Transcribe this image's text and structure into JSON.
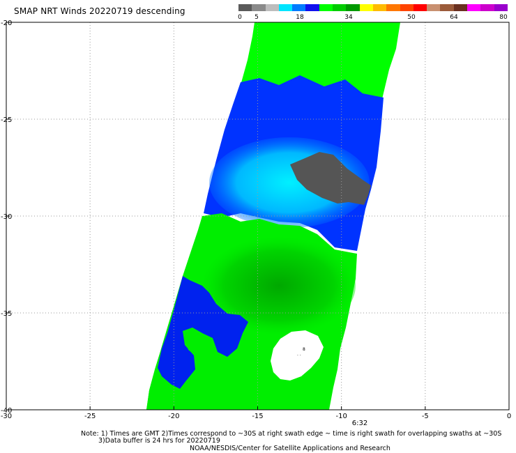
{
  "title": "SMAP NRT Winds  20220719  descending",
  "colorbar": {
    "labels": [
      "0",
      "5",
      "18",
      "34",
      "50",
      "64",
      "80"
    ],
    "segments": [
      {
        "color": "#5a5a5a"
      },
      {
        "color": "#8a8a8a"
      },
      {
        "color": "#bdbdbd"
      },
      {
        "color": "#00e5ff"
      },
      {
        "color": "#007bff"
      },
      {
        "color": "#1010ee"
      },
      {
        "color": "#00ff00"
      },
      {
        "color": "#00cc00"
      },
      {
        "color": "#009900"
      },
      {
        "color": "#ffff00"
      },
      {
        "color": "#ffbb00"
      },
      {
        "color": "#ff7700"
      },
      {
        "color": "#ff4400"
      },
      {
        "color": "#ff0000"
      },
      {
        "color": "#c89070"
      },
      {
        "color": "#9b5b3a"
      },
      {
        "color": "#6a3020"
      },
      {
        "color": "#ff00ff"
      },
      {
        "color": "#cc00cc"
      },
      {
        "color": "#9900cc"
      }
    ]
  },
  "map": {
    "lon_range": [
      -30,
      0
    ],
    "lat_range": [
      -40,
      -20
    ],
    "x_ticks": [
      "-30",
      "-25",
      "-20",
      "-15",
      "-10",
      "-5",
      "0"
    ],
    "y_ticks": [
      "-20",
      "-25",
      "-30",
      "-35",
      "-40"
    ],
    "time_label": "6:32",
    "colors": {
      "green": "#00ff00",
      "dark_green": "#00b800",
      "blue": "#0022ff",
      "cyan": "#00e0ff",
      "gray": "#555555",
      "grid": "#999999"
    }
  },
  "notes": {
    "line1": "Note: 1) Times are GMT 2)Times correspond to ~30S at right swath edge ~ time is right swath for overlapping swaths at ~30S",
    "line2": "3)Data buffer is 24 hrs for 20220719",
    "line3": "NOAA/NESDIS/Center for Satellite Applications and Research"
  }
}
